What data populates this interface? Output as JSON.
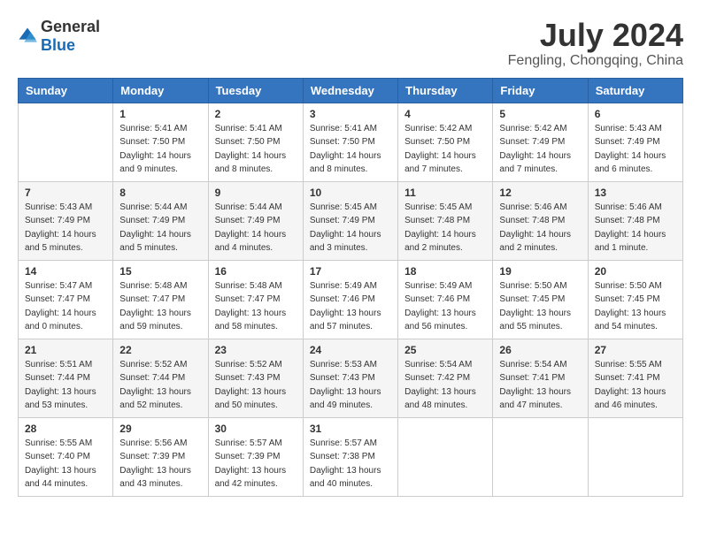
{
  "header": {
    "logo_general": "General",
    "logo_blue": "Blue",
    "month_title": "July 2024",
    "location": "Fengling, Chongqing, China"
  },
  "days_of_week": [
    "Sunday",
    "Monday",
    "Tuesday",
    "Wednesday",
    "Thursday",
    "Friday",
    "Saturday"
  ],
  "weeks": [
    [
      {
        "day": "",
        "info": ""
      },
      {
        "day": "1",
        "info": "Sunrise: 5:41 AM\nSunset: 7:50 PM\nDaylight: 14 hours\nand 9 minutes."
      },
      {
        "day": "2",
        "info": "Sunrise: 5:41 AM\nSunset: 7:50 PM\nDaylight: 14 hours\nand 8 minutes."
      },
      {
        "day": "3",
        "info": "Sunrise: 5:41 AM\nSunset: 7:50 PM\nDaylight: 14 hours\nand 8 minutes."
      },
      {
        "day": "4",
        "info": "Sunrise: 5:42 AM\nSunset: 7:50 PM\nDaylight: 14 hours\nand 7 minutes."
      },
      {
        "day": "5",
        "info": "Sunrise: 5:42 AM\nSunset: 7:49 PM\nDaylight: 14 hours\nand 7 minutes."
      },
      {
        "day": "6",
        "info": "Sunrise: 5:43 AM\nSunset: 7:49 PM\nDaylight: 14 hours\nand 6 minutes."
      }
    ],
    [
      {
        "day": "7",
        "info": "Sunrise: 5:43 AM\nSunset: 7:49 PM\nDaylight: 14 hours\nand 5 minutes."
      },
      {
        "day": "8",
        "info": "Sunrise: 5:44 AM\nSunset: 7:49 PM\nDaylight: 14 hours\nand 5 minutes."
      },
      {
        "day": "9",
        "info": "Sunrise: 5:44 AM\nSunset: 7:49 PM\nDaylight: 14 hours\nand 4 minutes."
      },
      {
        "day": "10",
        "info": "Sunrise: 5:45 AM\nSunset: 7:49 PM\nDaylight: 14 hours\nand 3 minutes."
      },
      {
        "day": "11",
        "info": "Sunrise: 5:45 AM\nSunset: 7:48 PM\nDaylight: 14 hours\nand 2 minutes."
      },
      {
        "day": "12",
        "info": "Sunrise: 5:46 AM\nSunset: 7:48 PM\nDaylight: 14 hours\nand 2 minutes."
      },
      {
        "day": "13",
        "info": "Sunrise: 5:46 AM\nSunset: 7:48 PM\nDaylight: 14 hours\nand 1 minute."
      }
    ],
    [
      {
        "day": "14",
        "info": "Sunrise: 5:47 AM\nSunset: 7:47 PM\nDaylight: 14 hours\nand 0 minutes."
      },
      {
        "day": "15",
        "info": "Sunrise: 5:48 AM\nSunset: 7:47 PM\nDaylight: 13 hours\nand 59 minutes."
      },
      {
        "day": "16",
        "info": "Sunrise: 5:48 AM\nSunset: 7:47 PM\nDaylight: 13 hours\nand 58 minutes."
      },
      {
        "day": "17",
        "info": "Sunrise: 5:49 AM\nSunset: 7:46 PM\nDaylight: 13 hours\nand 57 minutes."
      },
      {
        "day": "18",
        "info": "Sunrise: 5:49 AM\nSunset: 7:46 PM\nDaylight: 13 hours\nand 56 minutes."
      },
      {
        "day": "19",
        "info": "Sunrise: 5:50 AM\nSunset: 7:45 PM\nDaylight: 13 hours\nand 55 minutes."
      },
      {
        "day": "20",
        "info": "Sunrise: 5:50 AM\nSunset: 7:45 PM\nDaylight: 13 hours\nand 54 minutes."
      }
    ],
    [
      {
        "day": "21",
        "info": "Sunrise: 5:51 AM\nSunset: 7:44 PM\nDaylight: 13 hours\nand 53 minutes."
      },
      {
        "day": "22",
        "info": "Sunrise: 5:52 AM\nSunset: 7:44 PM\nDaylight: 13 hours\nand 52 minutes."
      },
      {
        "day": "23",
        "info": "Sunrise: 5:52 AM\nSunset: 7:43 PM\nDaylight: 13 hours\nand 50 minutes."
      },
      {
        "day": "24",
        "info": "Sunrise: 5:53 AM\nSunset: 7:43 PM\nDaylight: 13 hours\nand 49 minutes."
      },
      {
        "day": "25",
        "info": "Sunrise: 5:54 AM\nSunset: 7:42 PM\nDaylight: 13 hours\nand 48 minutes."
      },
      {
        "day": "26",
        "info": "Sunrise: 5:54 AM\nSunset: 7:41 PM\nDaylight: 13 hours\nand 47 minutes."
      },
      {
        "day": "27",
        "info": "Sunrise: 5:55 AM\nSunset: 7:41 PM\nDaylight: 13 hours\nand 46 minutes."
      }
    ],
    [
      {
        "day": "28",
        "info": "Sunrise: 5:55 AM\nSunset: 7:40 PM\nDaylight: 13 hours\nand 44 minutes."
      },
      {
        "day": "29",
        "info": "Sunrise: 5:56 AM\nSunset: 7:39 PM\nDaylight: 13 hours\nand 43 minutes."
      },
      {
        "day": "30",
        "info": "Sunrise: 5:57 AM\nSunset: 7:39 PM\nDaylight: 13 hours\nand 42 minutes."
      },
      {
        "day": "31",
        "info": "Sunrise: 5:57 AM\nSunset: 7:38 PM\nDaylight: 13 hours\nand 40 minutes."
      },
      {
        "day": "",
        "info": ""
      },
      {
        "day": "",
        "info": ""
      },
      {
        "day": "",
        "info": ""
      }
    ]
  ]
}
